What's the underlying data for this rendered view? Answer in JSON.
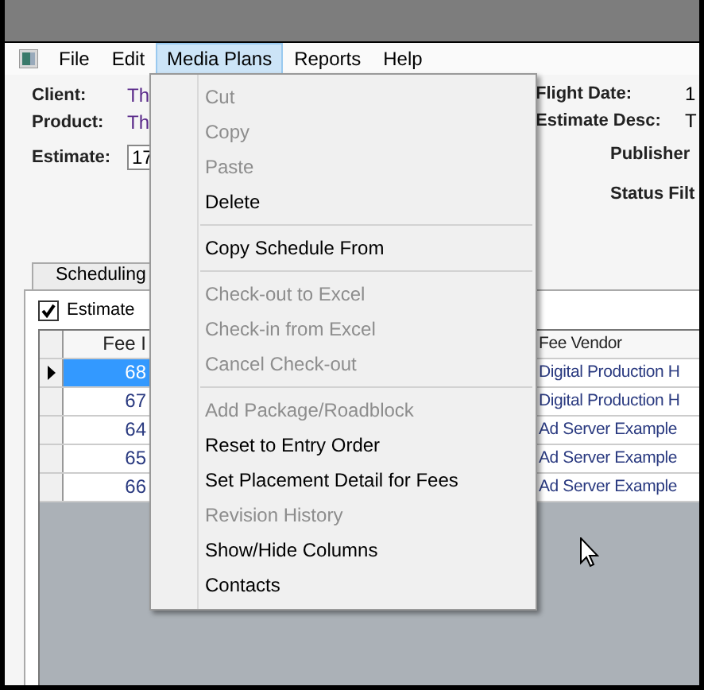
{
  "menu_bar": [
    {
      "label": "File",
      "selected": false
    },
    {
      "label": "Edit",
      "selected": false
    },
    {
      "label": "Media Plans",
      "selected": true
    },
    {
      "label": "Reports",
      "selected": false
    },
    {
      "label": "Help",
      "selected": false
    }
  ],
  "form_left": [
    {
      "label": "Client:",
      "value": "Th"
    },
    {
      "label": "Product:",
      "value": "Th"
    }
  ],
  "estimate": {
    "label": "Estimate:",
    "value": "17"
  },
  "form_right": [
    {
      "label": "Flight Date:",
      "value": "1"
    },
    {
      "label": "Estimate Desc:",
      "value": "T"
    }
  ],
  "filters": [
    {
      "label": "Publisher"
    },
    {
      "label": "Status Filt"
    }
  ],
  "tabs": [
    {
      "label": "Scheduling",
      "selected": true
    }
  ],
  "estimate_checkbox": {
    "label": "Estimate",
    "checked": true
  },
  "table": {
    "columns": [
      "Fee I",
      "Fee Vendor"
    ],
    "rows": [
      {
        "cells": [
          "68",
          "Digital Production H"
        ],
        "selected": true
      },
      {
        "cells": [
          "67",
          "Digital Production H"
        ],
        "selected": false
      },
      {
        "cells": [
          "64",
          "Ad Server Example"
        ],
        "selected": false
      },
      {
        "cells": [
          "65",
          "Ad Server Example"
        ],
        "selected": false
      },
      {
        "cells": [
          "66",
          "Ad Server Example"
        ],
        "selected": false
      }
    ]
  },
  "dropdown_menu": [
    {
      "kind": "item",
      "label": "Cut",
      "disabled": true
    },
    {
      "kind": "item",
      "label": "Copy",
      "disabled": true
    },
    {
      "kind": "item",
      "label": "Paste",
      "disabled": true
    },
    {
      "kind": "item",
      "label": "Delete",
      "disabled": false
    },
    {
      "kind": "separator"
    },
    {
      "kind": "item",
      "label": "Copy Schedule From",
      "disabled": false
    },
    {
      "kind": "separator"
    },
    {
      "kind": "item",
      "label": "Check-out to Excel",
      "disabled": true
    },
    {
      "kind": "item",
      "label": "Check-in from Excel",
      "disabled": true
    },
    {
      "kind": "item",
      "label": "Cancel Check-out",
      "disabled": true
    },
    {
      "kind": "separator"
    },
    {
      "kind": "item",
      "label": "Add Package/Roadblock",
      "disabled": true
    },
    {
      "kind": "item",
      "label": "Reset to Entry Order",
      "disabled": false
    },
    {
      "kind": "item",
      "label": "Set Placement Detail for Fees",
      "disabled": false
    },
    {
      "kind": "item",
      "label": "Revision History",
      "disabled": true
    },
    {
      "kind": "item",
      "label": "Show/Hide Columns",
      "disabled": false
    },
    {
      "kind": "item",
      "label": "Contacts",
      "disabled": false
    }
  ]
}
